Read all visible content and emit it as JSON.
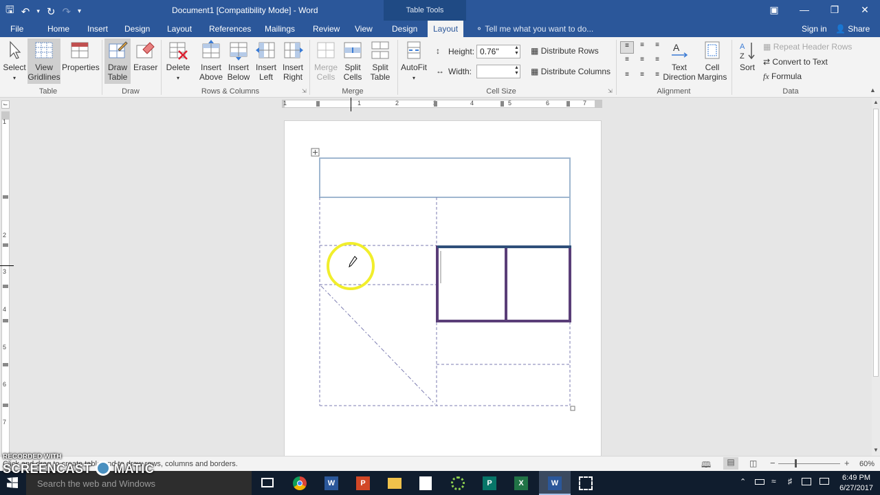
{
  "window": {
    "title": "Document1 [Compatibility Mode] - Word",
    "context_tools": "Table Tools"
  },
  "tabs": {
    "file": "File",
    "home": "Home",
    "insert": "Insert",
    "design": "Design",
    "layout": "Layout",
    "references": "References",
    "mailings": "Mailings",
    "review": "Review",
    "view": "View",
    "table_design": "Design",
    "table_layout": "Layout"
  },
  "tell_me": "Tell me what you want to do...",
  "sign_in": "Sign in",
  "share": "Share",
  "ribbon": {
    "select": "Select",
    "view_gridlines_1": "View",
    "view_gridlines_2": "Gridlines",
    "properties": "Properties",
    "draw_table_1": "Draw",
    "draw_table_2": "Table",
    "eraser": "Eraser",
    "delete": "Delete",
    "insert_above_1": "Insert",
    "insert_above_2": "Above",
    "insert_below_1": "Insert",
    "insert_below_2": "Below",
    "insert_left_1": "Insert",
    "insert_left_2": "Left",
    "insert_right_1": "Insert",
    "insert_right_2": "Right",
    "merge_cells_1": "Merge",
    "merge_cells_2": "Cells",
    "split_cells_1": "Split",
    "split_cells_2": "Cells",
    "split_table_1": "Split",
    "split_table_2": "Table",
    "autofit": "AutoFit",
    "height_label": "Height:",
    "height_value": "0.76\"",
    "width_label": "Width:",
    "width_value": "",
    "distribute_rows": "Distribute Rows",
    "distribute_columns": "Distribute Columns",
    "text_direction_1": "Text",
    "text_direction_2": "Direction",
    "cell_margins_1": "Cell",
    "cell_margins_2": "Margins",
    "sort": "Sort",
    "repeat_header_rows": "Repeat Header Rows",
    "convert_to_text": "Convert to Text",
    "formula": "Formula",
    "groups": {
      "table": "Table",
      "draw": "Draw",
      "rows_columns": "Rows & Columns",
      "merge": "Merge",
      "cell_size": "Cell Size",
      "alignment": "Alignment",
      "data": "Data"
    }
  },
  "ruler": {
    "numbers": [
      "1",
      "1",
      "2",
      "3",
      "4",
      "5",
      "6",
      "7"
    ]
  },
  "vruler": {
    "numbers": [
      "1",
      "2",
      "3",
      "4",
      "5",
      "6",
      "7"
    ]
  },
  "status": {
    "message": "Click and drag to create table and to draw rows, columns and borders.",
    "zoom": "60%"
  },
  "taskbar": {
    "search_placeholder": "Search the web and Windows",
    "time": "6:49 PM",
    "date": "6/27/2017"
  },
  "watermark": {
    "line1": "RECORDED WITH",
    "line2": "SCREENCAST",
    "line3": "MATIC"
  },
  "colors": {
    "title_blue": "#2b579a",
    "table_border_dark": "#5a3e78",
    "table_border_light": "#9fb6cf",
    "gridline": "#7b7bb0",
    "highlight_yellow": "#f1ee2c"
  }
}
